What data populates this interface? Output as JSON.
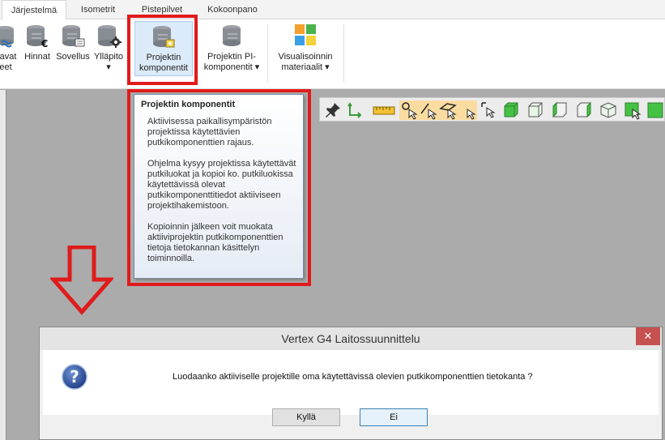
{
  "tabs": [
    "Järjestelmä",
    "Isometrit",
    "Pistepilvet",
    "Kokoonpano"
  ],
  "ribbon": {
    "buttons": [
      {
        "label1": "navat",
        "label2": "eet"
      },
      {
        "label1": "Hinnat",
        "label2": ""
      },
      {
        "label1": "Sovellus",
        "label2": ""
      },
      {
        "label1": "Ylläpito",
        "label2": "▾"
      },
      {
        "label1": "Projektin",
        "label2": "komponentit"
      },
      {
        "label1": "Projektin PI-",
        "label2": "komponentit ▾"
      },
      {
        "label1": "Visualisoinnin",
        "label2": "materiaalit ▾"
      }
    ]
  },
  "tooltip": {
    "title": "Projektin komponentit",
    "paragraphs": [
      "Aktiivisessa paikallisympäristön projektissa käytettävien putkikomponenttien rajaus.",
      "Ohjelma kysyy projektissa käytettävät putkiluokat ja kopioi ko. putkiluokissa käytettävissä olevat putkikomponenttitiedot aktiiviseen projektihakemistoon.",
      "Kopioinnin jälkeen voit muokata aktiiviprojektin putkikomponenttien tietoja tietokannan käsittelyn toiminnoilla."
    ]
  },
  "dialog": {
    "title": "Vertex G4 Laitossuunnittelu",
    "close": "✕",
    "message": "Luodaanko aktiiviselle projektille oma käytettävissä olevien putkikomponenttien tietokanta ?",
    "yes_label": "Kyllä",
    "no_label": "Ei"
  },
  "colors": {
    "highlight": "#e01b1b",
    "tooltip_border": "#7a8ba3",
    "toolbar_highlight": "#fbdca0",
    "help_icon": "#2b4f8f"
  },
  "icons": [
    "database-wave-icon",
    "database-euro-icon",
    "database-doc-icon",
    "database-gear-icon",
    "database-component-icon",
    "database-pi-icon",
    "color-squares-icon",
    "pin-icon",
    "arrow-path-icon",
    "ruler-icon",
    "select-icons",
    "green-cube-icons",
    "down-arrow-icon",
    "question-icon"
  ]
}
